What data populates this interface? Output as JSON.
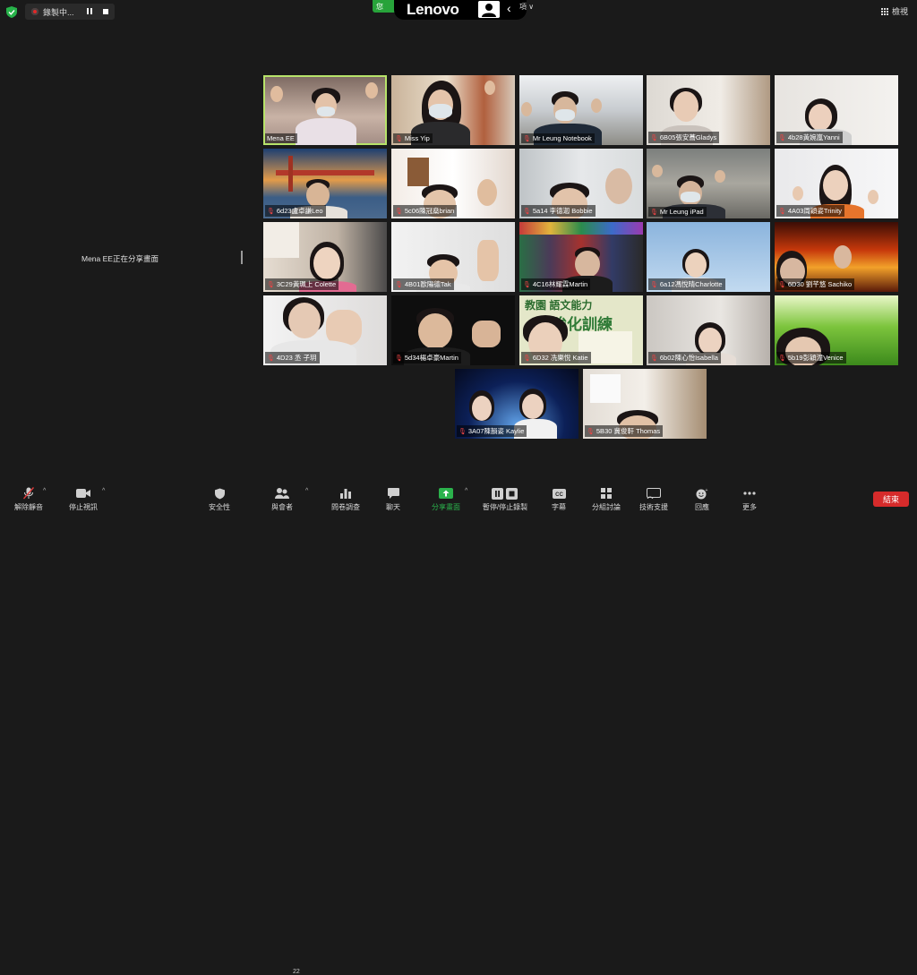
{
  "topbar": {
    "recording_label": "錄製中...",
    "green_pill_text": "您",
    "brand": "Lenovo",
    "view_options_text": "項 ∨",
    "gallery_label": "檢視"
  },
  "share_status": "Mena  EE正在分享畫面",
  "participants": [
    {
      "name": "Mena EE",
      "muted": false
    },
    {
      "name": "Miss Yip",
      "muted": true
    },
    {
      "name": "Mr Leung Notebook",
      "muted": true
    },
    {
      "name": "6B05張安蕎Gladys",
      "muted": true
    },
    {
      "name": "4b28黃婉嵐Yanni",
      "muted": true
    },
    {
      "name": "6d23盧卓謙Leo",
      "muted": true
    },
    {
      "name": "5c06陳冠燊brian",
      "muted": true
    },
    {
      "name": "5a14 李德迦 Bobbie",
      "muted": true
    },
    {
      "name": "Mr Leung iPad",
      "muted": true
    },
    {
      "name": "4A03周穎姿Trinity",
      "muted": true
    },
    {
      "name": "3C29黃珮上 Colette",
      "muted": true
    },
    {
      "name": "4B01歐陽德Tak",
      "muted": true
    },
    {
      "name": "4C16林耀霖Martin",
      "muted": true
    },
    {
      "name": "6a12馮悅晴Charlotte",
      "muted": true
    },
    {
      "name": "6D30 劉芊悠 Sachiko",
      "muted": true
    },
    {
      "name": "4D23 丞 子玥",
      "muted": true
    },
    {
      "name": "5d34楊卓豪Martin",
      "muted": true
    },
    {
      "name": "6D32 冼樂悅 Katie",
      "muted": true
    },
    {
      "name": "6b02陳心怡Isabella",
      "muted": true
    },
    {
      "name": "5b19彭穎潼Venice",
      "muted": true
    },
    {
      "name": "3A07陳韻姿 Kaylie",
      "muted": true
    },
    {
      "name": "5B30 冀俊軒 Thomas",
      "muted": true
    }
  ],
  "poster_text": {
    "line1": "教園 語文能力",
    "line2": "強化訓練"
  },
  "toolbar": {
    "unmute": "解除靜音",
    "stop_video": "停止視訊",
    "security": "安全性",
    "participants": "與會者",
    "participant_count": "22",
    "polls": "問卷調查",
    "chat": "聊天",
    "share_screen": "分享畫面",
    "pause_record": "暫停/停止錄製",
    "captions": "字幕",
    "breakout": "分組討論",
    "tech_support": "技術支援",
    "reactions": "回應",
    "more": "更多",
    "end": "結束"
  },
  "colors": {
    "accent_green": "#2bb24c",
    "end_red": "#d62b2b",
    "active_border": "#b7e36a",
    "background": "#1a1a1a"
  }
}
